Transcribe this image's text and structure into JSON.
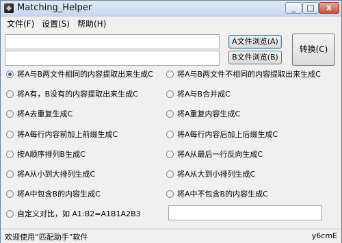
{
  "window": {
    "title": "Matching_Helper",
    "close_glyph": "x",
    "min_glyph": "_",
    "max_glyph": "□"
  },
  "menu": [
    "文件(F)",
    "设置(S)",
    "帮助(H)"
  ],
  "inputs": {
    "file_a": "",
    "file_b": "",
    "custom": ""
  },
  "buttons": {
    "browse_a": "A文件浏览(A)",
    "browse_b": "B文件浏览(B)",
    "convert": "转换(C)"
  },
  "options": [
    {
      "label": "将A与B两文件相同的内容提取出来生成C",
      "selected": true
    },
    {
      "label": "将A与B两文件不相同的内容提取出来生成C",
      "selected": false
    },
    {
      "label": "将A有，B没有的内容提取出来生成C",
      "selected": false
    },
    {
      "label": "将A与B合并成C",
      "selected": false
    },
    {
      "label": "将A去重复生成C",
      "selected": false
    },
    {
      "label": "将A重复内容生成C",
      "selected": false
    },
    {
      "label": "将A每行内容前加上前缀生成C",
      "selected": false
    },
    {
      "label": "将A每行内容后加上后缀生成C",
      "selected": false
    },
    {
      "label": "按A顺序排列B生成C",
      "selected": false
    },
    {
      "label": "将A从最后一行反向生成C",
      "selected": false
    },
    {
      "label": "将A从小到大排列生成C",
      "selected": false
    },
    {
      "label": "将A从大到小排列生成C",
      "selected": false
    },
    {
      "label": "将A中包含B的内容生成C",
      "selected": false
    },
    {
      "label": "将A中不包含B的内容生成C",
      "selected": false
    },
    {
      "label": "自定义对比，如 A1:B2=A1B1A2B3",
      "selected": false
    }
  ],
  "status": {
    "message": "欢迎使用“匹配助手”软件",
    "code": "y6cmE"
  }
}
